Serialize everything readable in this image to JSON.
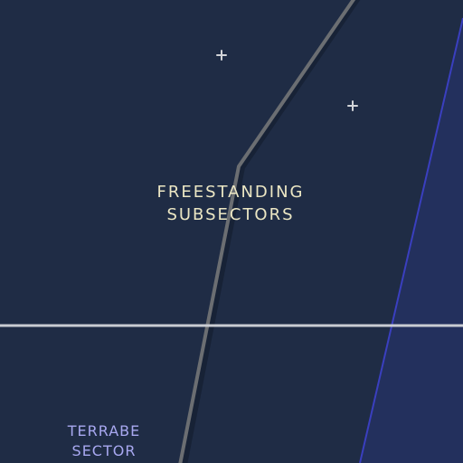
{
  "map": {
    "background_color": "#1f2c45",
    "region_label": {
      "lines": [
        "FREESTANDING",
        "SUBSECTORS"
      ],
      "color": "#ece7c4"
    },
    "sector_label": {
      "lines": [
        "TERRABE",
        "SECTOR"
      ],
      "color": "#a8a8f0"
    },
    "colors": {
      "grey_border": "#6b6e72",
      "horizontal_line": "#c9ccd2",
      "blue_boundary": "#3a3fbf",
      "blue_region_fill": "#23305d",
      "star_marker": "#d2d4d8"
    },
    "icons": {
      "star_marker": "plus-sign"
    }
  }
}
